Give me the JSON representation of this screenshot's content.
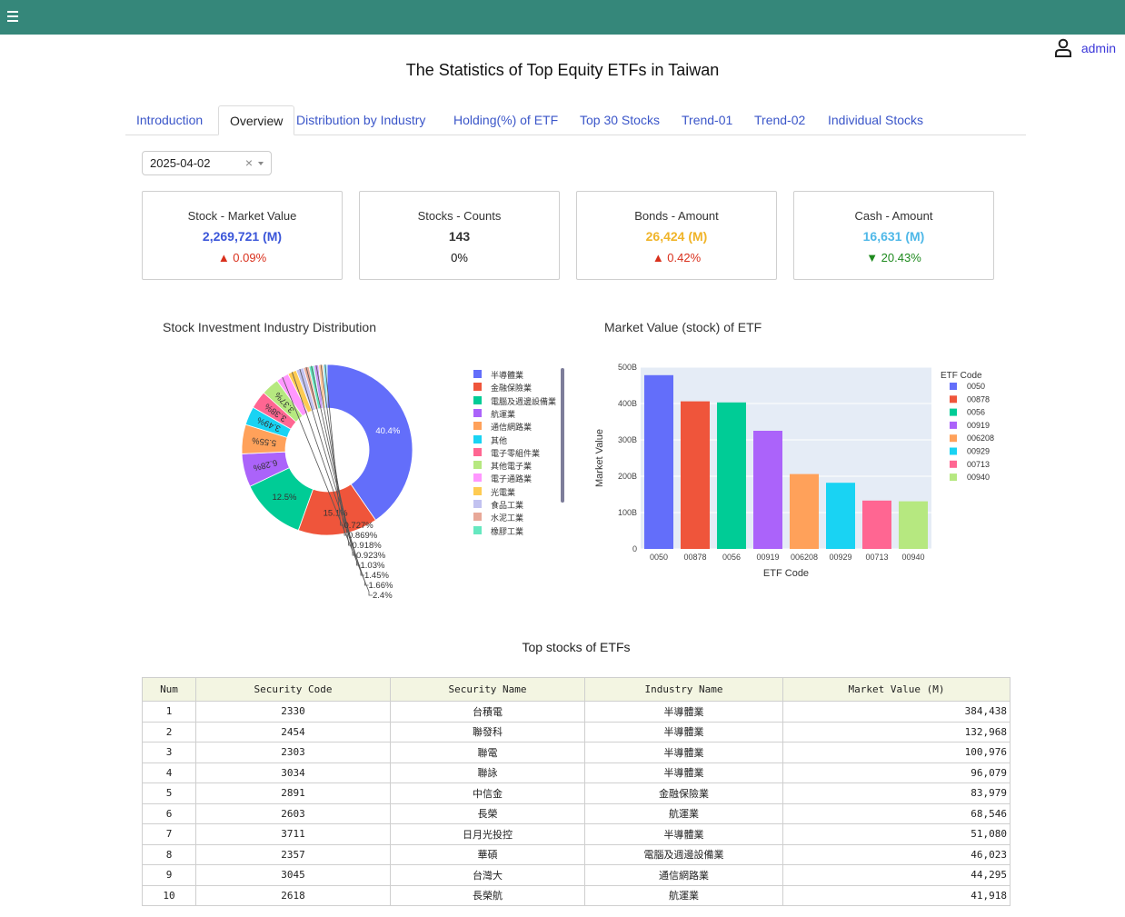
{
  "header": {
    "user": "admin"
  },
  "page": {
    "title": "The Statistics of Top Equity ETFs in Taiwan"
  },
  "tabs": [
    {
      "label": "Introduction"
    },
    {
      "label": "Overview"
    },
    {
      "label": "Distribution by Industry"
    },
    {
      "label": "Holding(%) of ETF"
    },
    {
      "label": "Top 30 Stocks"
    },
    {
      "label": "Trend-01"
    },
    {
      "label": "Trend-02"
    },
    {
      "label": "Individual Stocks"
    }
  ],
  "active_tab": "Overview",
  "date_picker": {
    "value": "2025-04-02",
    "clear": "×"
  },
  "cards": [
    {
      "title": "Stock - Market Value",
      "value": "2,269,721 (M)",
      "delta": "▲ 0.09%",
      "value_color": "#3b56d9",
      "delta_color": "#d9301c"
    },
    {
      "title": "Stocks - Counts",
      "value": "143",
      "delta": "0%",
      "value_color": "#333333",
      "delta_color": "#111111"
    },
    {
      "title": "Bonds - Amount",
      "value": "26,424 (M)",
      "delta": "▲ 0.42%",
      "value_color": "#f0b428",
      "delta_color": "#d9301c"
    },
    {
      "title": "Cash - Amount",
      "value": "16,631 (M)",
      "delta": "▼ 20.43%",
      "value_color": "#4fb8e8",
      "delta_color": "#1e8a1e"
    }
  ],
  "pie_title": "Stock Investment Industry Distribution",
  "bar_title": "Market Value (stock) of ETF",
  "table_title": "Top stocks of ETFs",
  "chart_data": [
    {
      "type": "pie",
      "hole": true,
      "slices": [
        {
          "label": "半導體業",
          "value": 40.4,
          "color": "#636efa"
        },
        {
          "label": "金融保險業",
          "value": 15.1,
          "color": "#ef553b"
        },
        {
          "label": "電腦及週邊設備業",
          "value": 12.5,
          "color": "#00cc96"
        },
        {
          "label": "航運業",
          "value": 6.28,
          "color": "#ab63fa"
        },
        {
          "label": "通信網路業",
          "value": 5.55,
          "color": "#ffa15a"
        },
        {
          "label": "其他",
          "value": 3.49,
          "color": "#19d3f3"
        },
        {
          "label": "電子零組件業",
          "value": 3.38,
          "color": "#ff6692"
        },
        {
          "label": "其他電子業",
          "value": 3.37,
          "color": "#b6e880"
        },
        {
          "label": "電子通路業",
          "value": 2.4,
          "color": "#ff97ff"
        },
        {
          "label": "光電業",
          "value": 1.66,
          "color": "#fecb52"
        },
        {
          "label": "食品工業",
          "value": 1.45,
          "color": "#c2c2f0"
        },
        {
          "label": "水泥工業",
          "value": 1.03,
          "color": "#e8a898"
        },
        {
          "label": "橡膠工業",
          "value": 0.923,
          "color": "#66e8c0"
        },
        {
          "label": "",
          "value": 0.918,
          "color": "#c89bf6"
        },
        {
          "label": "",
          "value": 0.869,
          "color": "#ffc59a"
        },
        {
          "label": "",
          "value": 0.727,
          "color": "#8ce5f9"
        }
      ],
      "value_labels": [
        "40.4%",
        "15.1%",
        "12.5%",
        "6.28%",
        "5.55%",
        "3.49%",
        "3.38%",
        "3.37%",
        "2.4%",
        "1.66%",
        "1.45%",
        "1.03%",
        "0.923%",
        "0.918%",
        "0.869%",
        "0.727%"
      ]
    },
    {
      "type": "bar",
      "xlabel": "ETF Code",
      "ylabel": "Market Value",
      "legend_title": "ETF Code",
      "ylim": [
        0,
        500
      ],
      "yticks": [
        "0",
        "100B",
        "200B",
        "300B",
        "400B",
        "500B"
      ],
      "categories": [
        "0050",
        "00878",
        "0056",
        "00919",
        "006208",
        "00929",
        "00713",
        "00940"
      ],
      "values": [
        478,
        406,
        403,
        325,
        206,
        182,
        133,
        131
      ],
      "colors": [
        "#636efa",
        "#ef553b",
        "#00cc96",
        "#ab63fa",
        "#ffa15a",
        "#19d3f3",
        "#ff6692",
        "#b6e880"
      ]
    }
  ],
  "table": {
    "headers": [
      "Num",
      "Security Code",
      "Security Name",
      "Industry Name",
      "Market Value (M)"
    ],
    "rows": [
      [
        "1",
        "2330",
        "台積電",
        "半導體業",
        "384,438"
      ],
      [
        "2",
        "2454",
        "聯發科",
        "半導體業",
        "132,968"
      ],
      [
        "3",
        "2303",
        "聯電",
        "半導體業",
        "100,976"
      ],
      [
        "4",
        "3034",
        "聯詠",
        "半導體業",
        "96,079"
      ],
      [
        "5",
        "2891",
        "中信金",
        "金融保險業",
        "83,979"
      ],
      [
        "6",
        "2603",
        "長榮",
        "航運業",
        "68,546"
      ],
      [
        "7",
        "3711",
        "日月光投控",
        "半導體業",
        "51,080"
      ],
      [
        "8",
        "2357",
        "華碩",
        "電腦及週邊設備業",
        "46,023"
      ],
      [
        "9",
        "3045",
        "台灣大",
        "通信網路業",
        "44,295"
      ],
      [
        "10",
        "2618",
        "長榮航",
        "航運業",
        "41,918"
      ]
    ]
  }
}
